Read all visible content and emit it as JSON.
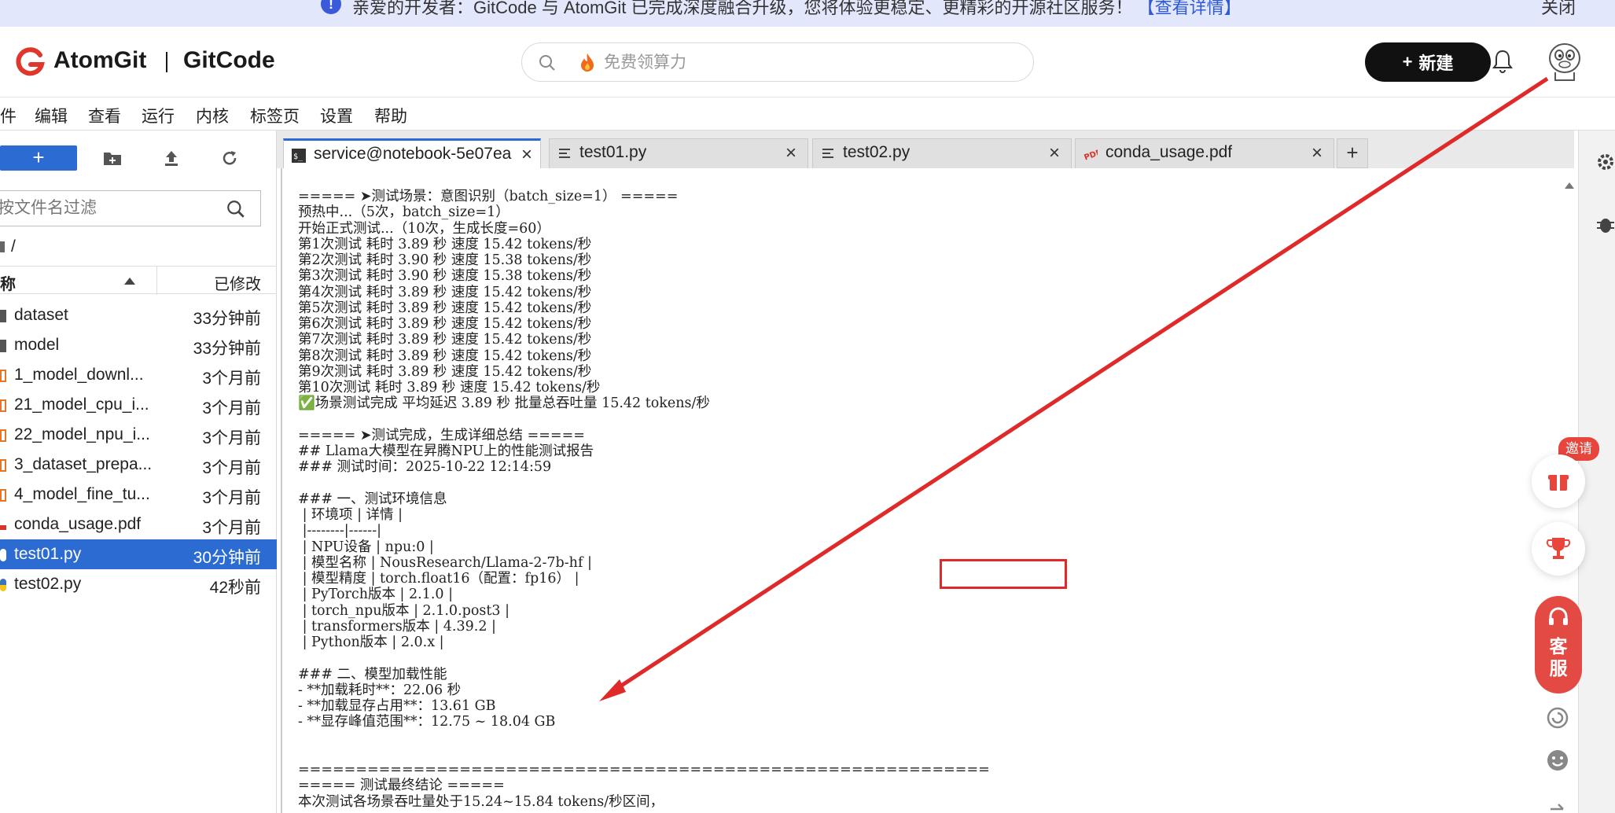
{
  "banner": {
    "text": "亲爱的开发者：GitCode 与 AtomGit 已完成深度融合升级，您将体验更稳定、更精彩的开源社区服务！",
    "link": "【查看详情】",
    "close": "关闭"
  },
  "header": {
    "brand1": "AtomGit",
    "brand2": "GitCode",
    "search_placeholder": "免费领算力",
    "new_button": "新建"
  },
  "menu": [
    "件",
    "编辑",
    "查看",
    "运行",
    "内核",
    "标签页",
    "设置",
    "帮助"
  ],
  "file_panel": {
    "new_label": "+",
    "filter_placeholder": "按文件名过滤",
    "path": "/",
    "col_name": "称",
    "col_modified": "已修改",
    "files": [
      {
        "name": "dataset",
        "time": "33分钟前",
        "type": "folder"
      },
      {
        "name": "model",
        "time": "33分钟前",
        "type": "folder"
      },
      {
        "name": "1_model_downl...",
        "time": "3个月前",
        "type": "notebook"
      },
      {
        "name": "21_model_cpu_i...",
        "time": "3个月前",
        "type": "notebook"
      },
      {
        "name": "22_model_npu_i...",
        "time": "3个月前",
        "type": "notebook"
      },
      {
        "name": "3_dataset_prepa...",
        "time": "3个月前",
        "type": "notebook"
      },
      {
        "name": "4_model_fine_tu...",
        "time": "3个月前",
        "type": "notebook"
      },
      {
        "name": "conda_usage.pdf",
        "time": "3个月前",
        "type": "pdf"
      },
      {
        "name": "test01.py",
        "time": "30分钟前",
        "type": "python",
        "selected": true
      },
      {
        "name": "test02.py",
        "time": "42秒前",
        "type": "python"
      }
    ]
  },
  "tabs": [
    {
      "label": "service@notebook-5e07ea",
      "icon": "terminal-icon",
      "active": true
    },
    {
      "label": "test01.py",
      "icon": "file-text-icon",
      "active": false
    },
    {
      "label": "test02.py",
      "icon": "file-text-icon",
      "active": false
    },
    {
      "label": "conda_usage.pdf",
      "icon": "pdf-icon",
      "active": false
    }
  ],
  "terminal_lines": [
    "===== ➤测试场景：意图识别（batch_size=1） =====",
    "预热中...（5次，batch_size=1）",
    "开始正式测试...（10次，生成长度=60）",
    "第1次测试 耗时 3.89 秒 速度 15.42 tokens/秒",
    "第2次测试 耗时 3.90 秒 速度 15.38 tokens/秒",
    "第3次测试 耗时 3.90 秒 速度 15.38 tokens/秒",
    "第4次测试 耗时 3.89 秒 速度 15.42 tokens/秒",
    "第5次测试 耗时 3.89 秒 速度 15.42 tokens/秒",
    "第6次测试 耗时 3.89 秒 速度 15.42 tokens/秒",
    "第7次测试 耗时 3.89 秒 速度 15.42 tokens/秒",
    "第8次测试 耗时 3.89 秒 速度 15.42 tokens/秒",
    "第9次测试 耗时 3.89 秒 速度 15.42 tokens/秒",
    "第10次测试 耗时 3.89 秒 速度 15.42 tokens/秒",
    "✅场景测试完成 平均延迟 3.89 秒 批量总吞吐量 15.42 tokens/秒",
    "",
    "===== ➤测试完成，生成详细总结 =====",
    "## Llama大模型在昇腾NPU上的性能测试报告",
    "### 测试时间：2025-10-22 12:14:59",
    "",
    "### 一、测试环境信息",
    " | 环境项 | 详情 |",
    " |--------|------|",
    " | NPU设备 | npu:0 |",
    " | 模型名称 | NousResearch/Llama-2-7b-hf |",
    " | 模型精度 | torch.float16（配置：fp16） |",
    " | PyTorch版本 | 2.1.0 |",
    " | torch_npu版本 | 2.1.0.post3 |",
    " | transformers版本 | 4.39.2 |",
    " | Python版本 | 2.0.x |",
    "",
    "### 二、模型加载性能",
    "- **加载耗时**：22.06 秒",
    "- **加载显存占用**：13.61 GB",
    "- **显存峰值范围**：12.75 ~ 18.04 GB",
    "",
    "",
    "============================================================",
    "===== 测试最终结论 =====",
    "本次测试各场景吞吐量处于15.24~15.84 tokens/秒区间，"
  ],
  "widgets": {
    "invite": "邀请",
    "service": "客\n服"
  },
  "colors": {
    "accent": "#2c6bd1",
    "annotation": "#e02a2a",
    "service": "#e34a43"
  }
}
